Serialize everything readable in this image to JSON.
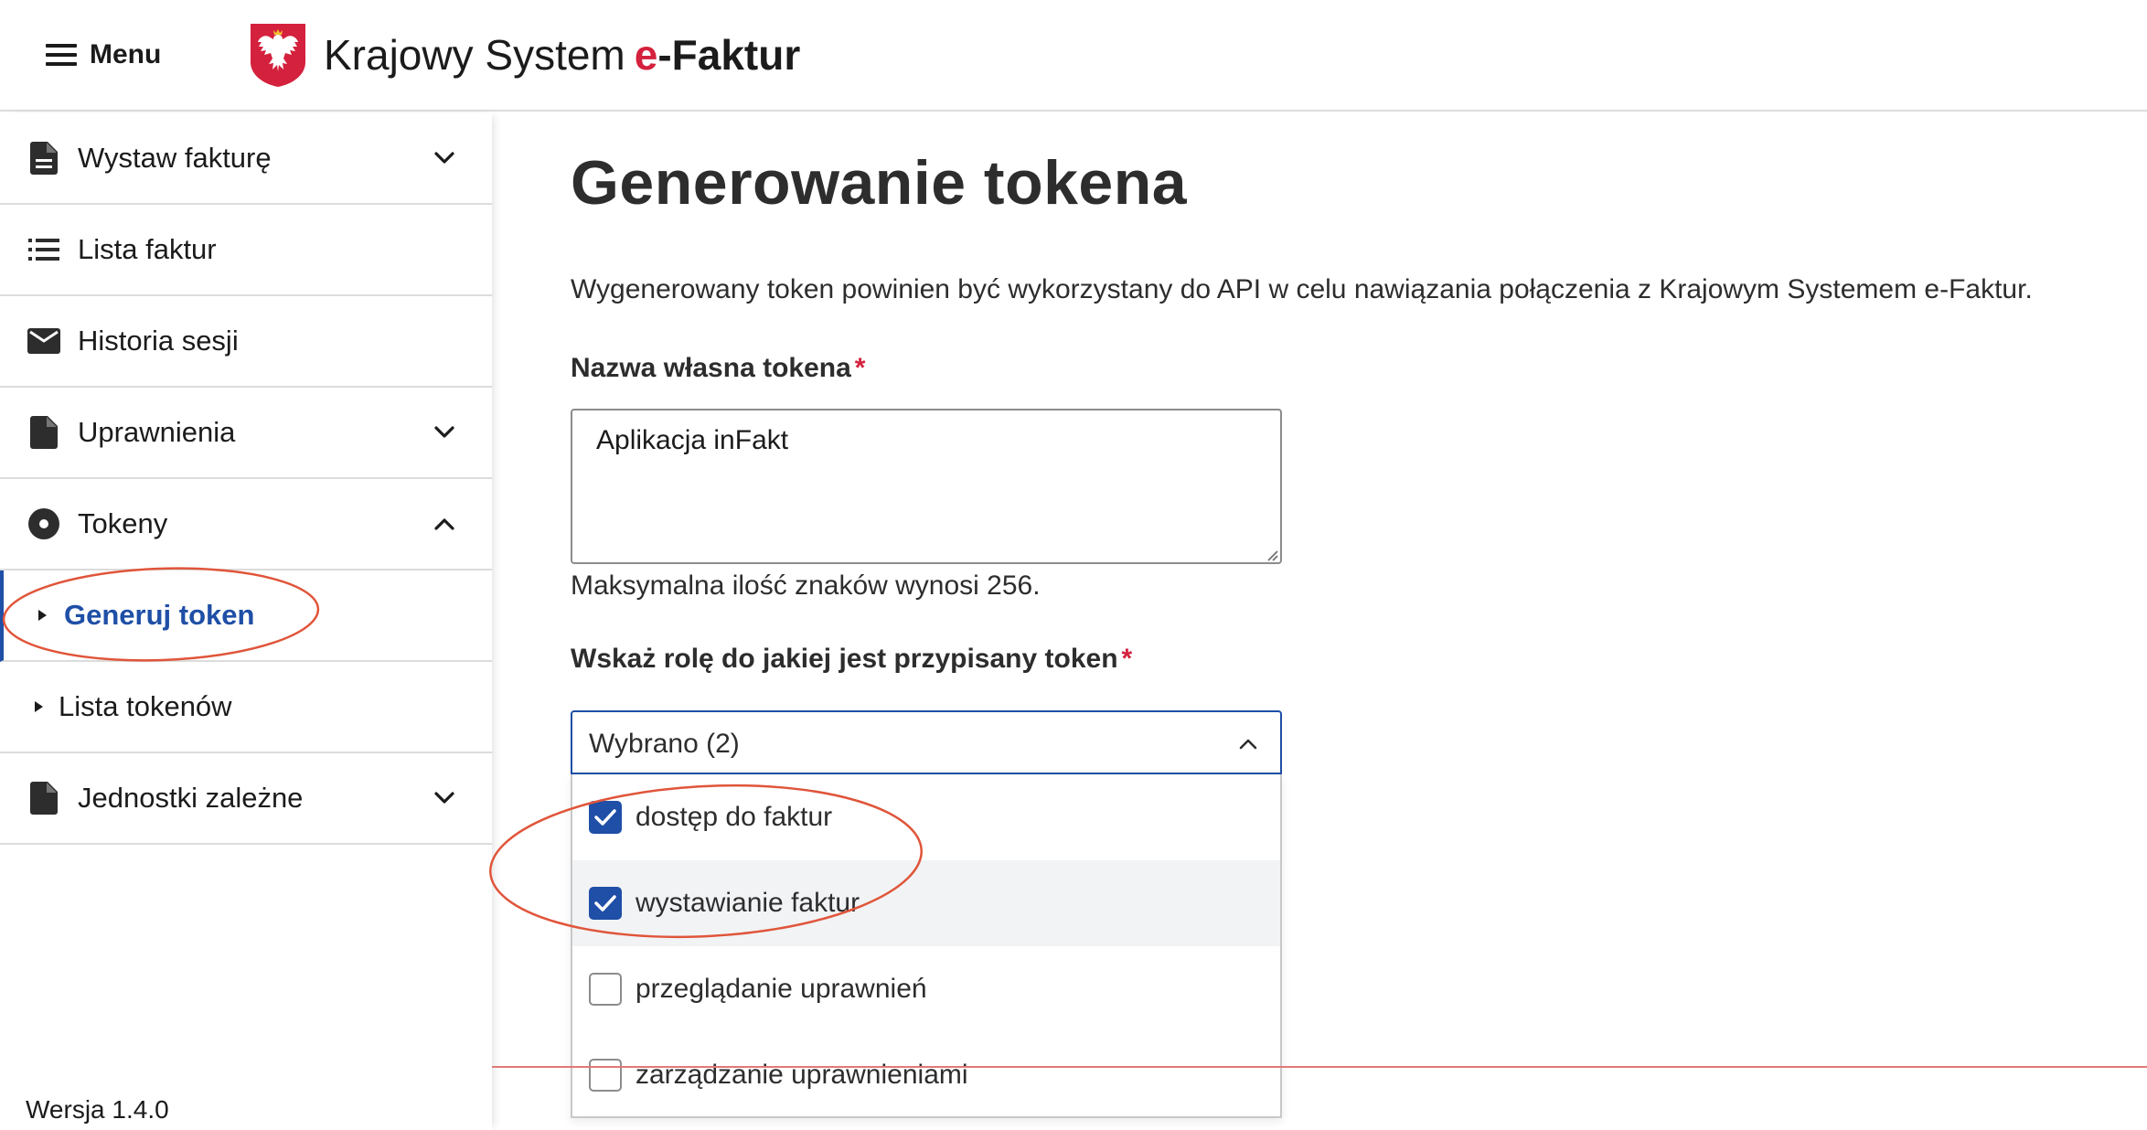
{
  "header": {
    "menu_label": "Menu",
    "title_plain": "Krajowy System",
    "title_brand_e": "e",
    "title_brand_rest": "-Faktur"
  },
  "sidebar": {
    "items": [
      {
        "label": "Wystaw fakturę",
        "icon": "document-icon",
        "expandable": true,
        "expanded": false
      },
      {
        "label": "Lista faktur",
        "icon": "list-icon",
        "expandable": false
      },
      {
        "label": "Historia sesji",
        "icon": "mail-icon",
        "expandable": false
      },
      {
        "label": "Uprawnienia",
        "icon": "document-icon",
        "expandable": true,
        "expanded": false
      },
      {
        "label": "Tokeny",
        "icon": "disc-icon",
        "expandable": true,
        "expanded": true
      },
      {
        "label": "Jednostki zależne",
        "icon": "document-icon",
        "expandable": true,
        "expanded": false
      }
    ],
    "sub_items": [
      {
        "label": "Generuj token",
        "active": true
      },
      {
        "label": "Lista tokenów",
        "active": false
      }
    ],
    "version": "Wersja 1.4.0"
  },
  "main": {
    "title": "Generowanie tokena",
    "description": "Wygenerowany token powinien być wykorzystany do API w celu nawiązania połączenia z Krajowym Systemem e-Faktur.",
    "token_name_label": "Nazwa własna tokena",
    "required_mark": "*",
    "token_name_value": "Aplikacja inFakt",
    "token_name_hint": "Maksymalna ilość znaków wynosi 256.",
    "role_label": "Wskaż rolę do jakiej jest przypisany token",
    "role_select_value": "Wybrano (2)",
    "role_options": [
      {
        "label": "dostęp do faktur",
        "checked": true
      },
      {
        "label": "wystawianie faktur",
        "checked": true
      },
      {
        "label": "przeglądanie uprawnień",
        "checked": false
      },
      {
        "label": "zarządzanie uprawnieniami",
        "checked": false
      }
    ]
  },
  "colors": {
    "accent_blue": "#1f4fa6",
    "brand_red": "#d4213d",
    "annotation_red": "#e0553a"
  }
}
